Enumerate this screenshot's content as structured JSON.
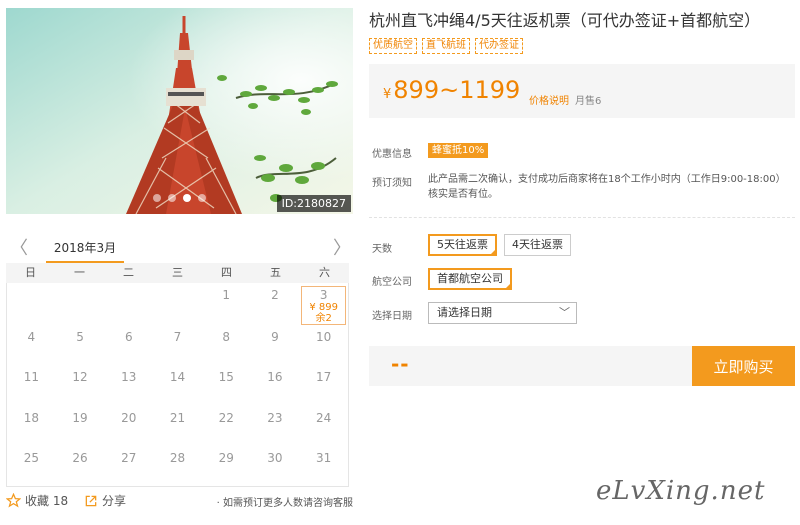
{
  "product": {
    "title": "杭州直飞冲绳4/5天往返机票（可代办签证+首都航空）",
    "tags": [
      "优质航空",
      "直飞航班",
      "代办签证"
    ],
    "image_id": "ID:2180827",
    "carousel_count": 4,
    "carousel_active": 2
  },
  "price": {
    "currency": "¥",
    "range": "899~1199",
    "note_link": "价格说明",
    "monthly_sales": "月售6"
  },
  "info": {
    "promo_label": "优惠信息",
    "promo_badge": "蜂蜜抵10%",
    "booking_label": "预订须知",
    "booking_text": "此产品需二次确认，支付成功后商家将在18个工作小时内（工作日9:00-18:00）核实是否有位。"
  },
  "options": {
    "days_label": "天数",
    "days": [
      "5天往返票",
      "4天往返票"
    ],
    "days_selected": 0,
    "airline_label": "航空公司",
    "airlines": [
      "首都航空公司"
    ],
    "date_label": "选择日期",
    "date_placeholder": "请选择日期",
    "chevron_glyph": "﹀"
  },
  "buy": {
    "total": "--",
    "button_label": "立即购买"
  },
  "calendar": {
    "month": "2018年3月",
    "prev_glyph": "〈",
    "next_glyph": "〉",
    "weekdays": [
      "日",
      "一",
      "二",
      "三",
      "四",
      "五",
      "六"
    ],
    "leading_blank_days": 4,
    "days": [
      {
        "day": "1"
      },
      {
        "day": "2"
      },
      {
        "day": "3",
        "price": "¥ 899",
        "remain": "余2"
      },
      {
        "day": "4"
      },
      {
        "day": "5"
      },
      {
        "day": "6"
      },
      {
        "day": "7"
      },
      {
        "day": "8"
      },
      {
        "day": "9"
      },
      {
        "day": "10"
      },
      {
        "day": "11"
      },
      {
        "day": "12"
      },
      {
        "day": "13"
      },
      {
        "day": "14"
      },
      {
        "day": "15"
      },
      {
        "day": "16"
      },
      {
        "day": "17"
      },
      {
        "day": "18"
      },
      {
        "day": "19"
      },
      {
        "day": "20"
      },
      {
        "day": "21"
      },
      {
        "day": "22"
      },
      {
        "day": "23"
      },
      {
        "day": "24"
      },
      {
        "day": "25"
      },
      {
        "day": "26"
      },
      {
        "day": "27"
      },
      {
        "day": "28"
      },
      {
        "day": "29"
      },
      {
        "day": "30"
      },
      {
        "day": "31"
      }
    ]
  },
  "bottom": {
    "favorite_label": "收藏 18",
    "share_label": "分享",
    "service_tip": "· 如需预订更多人数请咨询客服"
  },
  "watermark": "eLvXing.net",
  "colors": {
    "accent": "#f39a1e",
    "price": "#f08300"
  }
}
